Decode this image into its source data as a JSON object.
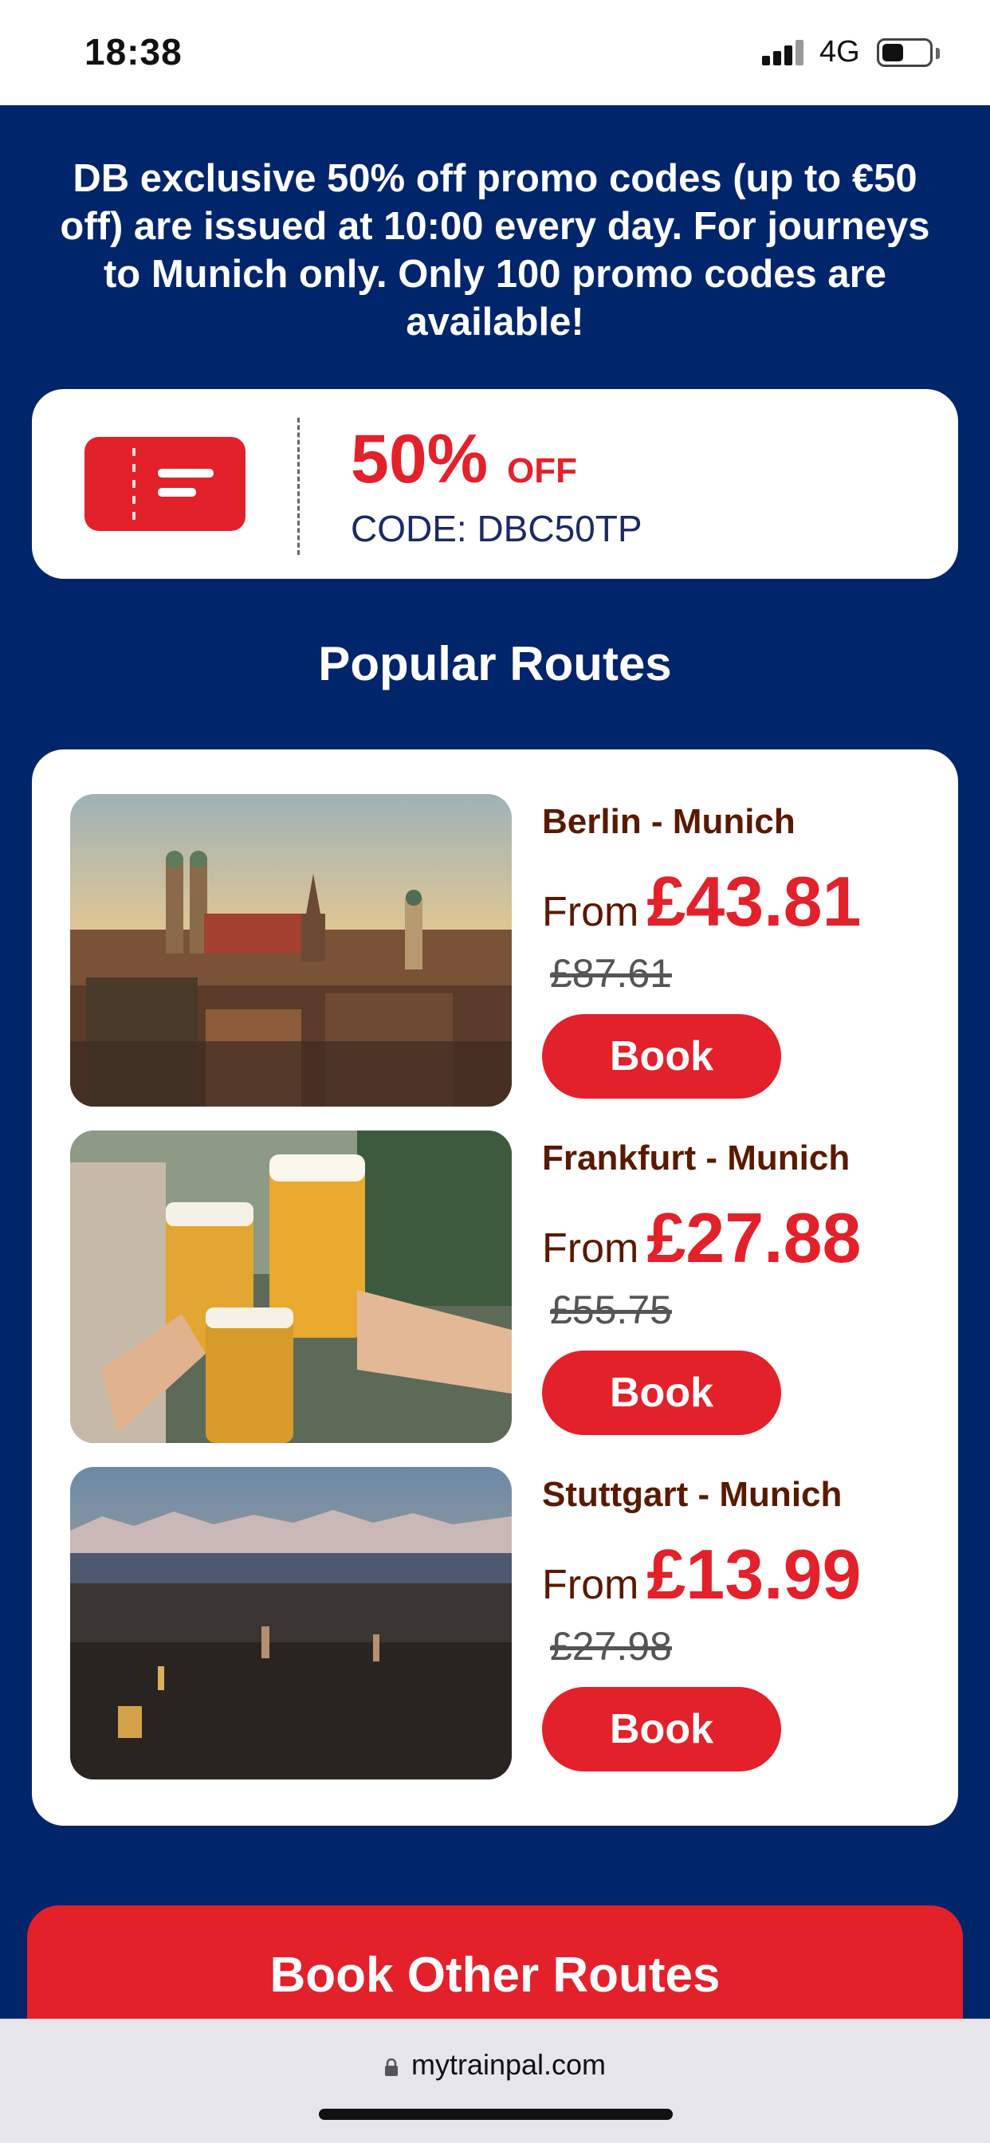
{
  "status_bar": {
    "time": "18:38",
    "network": "4G",
    "icons": [
      "signal-icon",
      "battery-icon"
    ]
  },
  "notice": {
    "text": "DB exclusive 50% off promo codes (up to €50 off) are issued at 10:00 every day. For journeys to Munich only. Only 100 promo codes are available!"
  },
  "coupon": {
    "icon": "ticket-icon",
    "percent": "50%",
    "off_label": "OFF",
    "code_text": "CODE: DBC50TP"
  },
  "popular": {
    "title": "Popular Routes",
    "routes": [
      {
        "name": "Berlin - Munich",
        "from_label": "From",
        "price": "£43.81",
        "old_price": "£87.61",
        "button": "Book",
        "image": "munich-skyline-photo"
      },
      {
        "name": "Frankfurt - Munich",
        "from_label": "From",
        "price": "£27.88",
        "old_price": "£55.75",
        "button": "Book",
        "image": "beer-toast-photo"
      },
      {
        "name": "Stuttgart - Munich",
        "from_label": "From",
        "price": "£13.99",
        "old_price": "£27.98",
        "button": "Book",
        "image": "munich-alps-panorama-photo"
      }
    ]
  },
  "cta": {
    "label": "Book Other Routes"
  },
  "browser": {
    "url": "mytrainpal.com"
  },
  "colors": {
    "background_blue": "#00256b",
    "accent_red": "#e3212b",
    "route_name_brown": "#5a1a00",
    "code_navy": "#1d2a66"
  }
}
